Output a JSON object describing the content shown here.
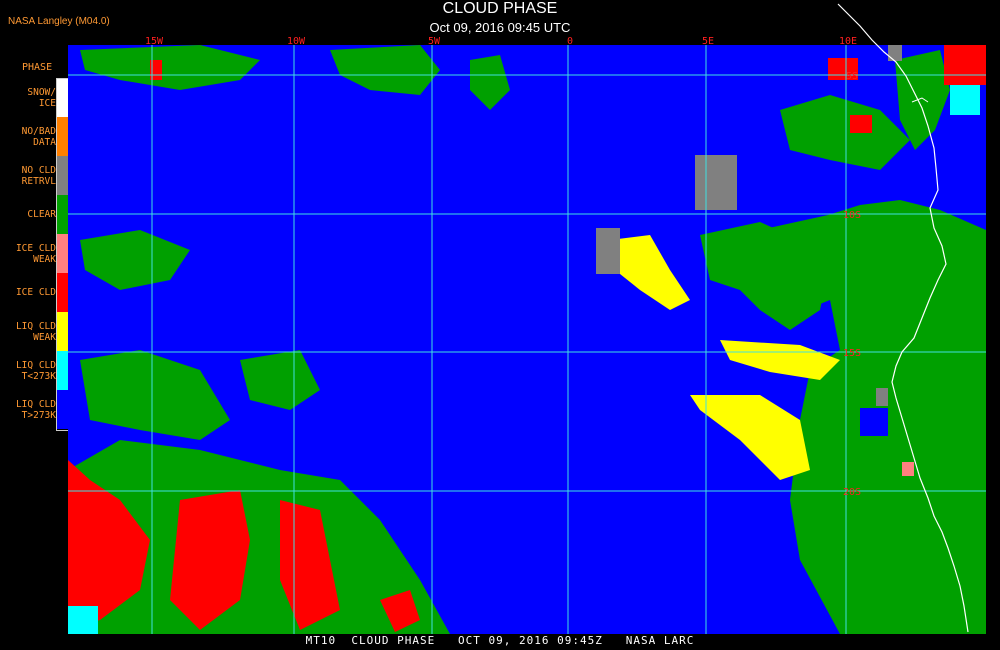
{
  "header": {
    "title": "CLOUD PHASE",
    "date": "Oct 09, 2016 09:45 UTC",
    "producer": "NASA Langley (M04.0)"
  },
  "legend": {
    "title": "PHASE",
    "items": [
      {
        "label1": "SNOW/",
        "label2": "ICE",
        "color": "#ffffff"
      },
      {
        "label1": "NO/BAD",
        "label2": "DATA",
        "color": "#ff8000"
      },
      {
        "label1": "NO CLD",
        "label2": "RETRVL",
        "color": "#808080"
      },
      {
        "label1": "CLEAR",
        "label2": "",
        "color": "#00a000"
      },
      {
        "label1": "ICE CLD",
        "label2": "WEAK",
        "color": "#ff8080"
      },
      {
        "label1": "ICE CLD",
        "label2": "",
        "color": "#ff0000"
      },
      {
        "label1": "LIQ CLD",
        "label2": "WEAK",
        "color": "#ffff00"
      },
      {
        "label1": "LIQ CLD",
        "label2": "T<273K",
        "color": "#00ffff"
      },
      {
        "label1": "LIQ CLD",
        "label2": "T>273K",
        "color": "#0000ff"
      }
    ]
  },
  "map": {
    "lon_labels": [
      "15W",
      "10W",
      "5W",
      "0",
      "5E",
      "10E"
    ],
    "lat_labels": [
      "5S",
      "10S",
      "15S",
      "20S"
    ],
    "grid_color": "#40e0e0",
    "label_color": "#ff2020",
    "coast_color": "#ffffff"
  },
  "footer": "MT10  CLOUD PHASE   OCT 09, 2016 09:45Z   NASA LARC"
}
